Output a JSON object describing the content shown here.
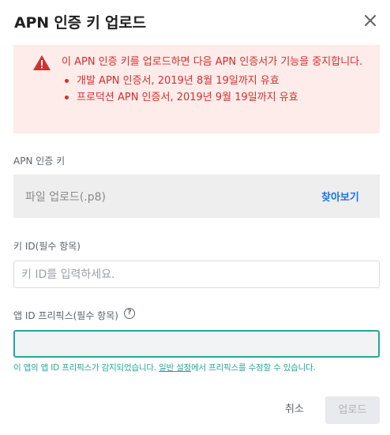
{
  "dialog": {
    "title": "APN 인증 키 업로드",
    "close_icon": "close-icon"
  },
  "warning": {
    "icon": "warning-triangle-icon",
    "message": "이 APN 인증 키를 업로드하면 다음 APN 인증서가 기능을 중지합니다.",
    "items": [
      "개발 APN 인증서, 2019년 8월 19일까지 유효",
      "프로덕션 APN 인증서, 2019년 9월 19일까지 유효"
    ],
    "color": "#d32f2f",
    "background": "#fdecea"
  },
  "auth_key": {
    "label": "APN 인증 키",
    "file_placeholder": "파일 업로드(.p8)",
    "browse_label": "찾아보기"
  },
  "key_id": {
    "label": "키 ID(필수 항목)",
    "placeholder": "키 ID를 입력하세요.",
    "value": ""
  },
  "app_id_prefix": {
    "label": "앱 ID 프리픽스(필수 항목)",
    "help_icon": "help-circle-icon",
    "value": "",
    "hint_before": "이 앱의 앱 ID 프리픽스가 감지되었습니다. ",
    "hint_link": "일반 설정",
    "hint_after": "에서 프리픽스를 수정할 수 있습니다.",
    "accent_color": "#26a69a"
  },
  "actions": {
    "cancel_label": "취소",
    "upload_label": "업로드",
    "link_color": "#1a73e8"
  }
}
